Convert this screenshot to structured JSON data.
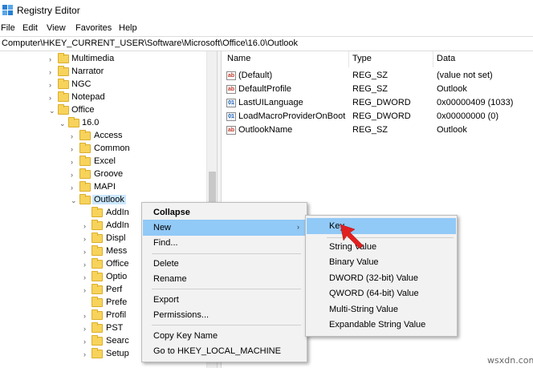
{
  "window": {
    "title": "Registry Editor"
  },
  "menubar": [
    "File",
    "Edit",
    "View",
    "Favorites",
    "Help"
  ],
  "address": "Computer\\HKEY_CURRENT_USER\\Software\\Microsoft\\Office\\16.0\\Outlook",
  "tree": [
    {
      "label": "Multimedia",
      "expanded": false
    },
    {
      "label": "Narrator",
      "expanded": false
    },
    {
      "label": "NGC",
      "expanded": false
    },
    {
      "label": "Notepad",
      "expanded": false
    },
    {
      "label": "Office",
      "expanded": true
    },
    {
      "label": "16.0",
      "expanded": true
    },
    {
      "label": "Access",
      "expanded": false
    },
    {
      "label": "Common",
      "expanded": false
    },
    {
      "label": "Excel",
      "expanded": false
    },
    {
      "label": "Groove",
      "expanded": false
    },
    {
      "label": "MAPI",
      "expanded": false
    },
    {
      "label": "Outlook",
      "expanded": true,
      "selected": true
    },
    {
      "label": "AddIn",
      "expanded": false
    },
    {
      "label": "AddIn",
      "expanded": false
    },
    {
      "label": "Displ",
      "expanded": false
    },
    {
      "label": "Mess",
      "expanded": false
    },
    {
      "label": "Office",
      "expanded": false
    },
    {
      "label": "Optio",
      "expanded": false
    },
    {
      "label": "Perf",
      "expanded": false
    },
    {
      "label": "Prefe",
      "expanded": false
    },
    {
      "label": "Profil",
      "expanded": false
    },
    {
      "label": "PST",
      "expanded": false
    },
    {
      "label": "Searc",
      "expanded": false
    },
    {
      "label": "Setup",
      "expanded": false
    }
  ],
  "values": {
    "headers": {
      "name": "Name",
      "type": "Type",
      "data": "Data"
    },
    "rows": [
      {
        "icon": "string-value-icon",
        "name": "(Default)",
        "type": "REG_SZ",
        "data": "(value not set)"
      },
      {
        "icon": "string-value-icon",
        "name": "DefaultProfile",
        "type": "REG_SZ",
        "data": "Outlook"
      },
      {
        "icon": "dword-value-icon",
        "name": "LastUILanguage",
        "type": "REG_DWORD",
        "data": "0x00000409 (1033)"
      },
      {
        "icon": "dword-value-icon",
        "name": "LoadMacroProviderOnBoot",
        "type": "REG_DWORD",
        "data": "0x00000000 (0)"
      },
      {
        "icon": "string-value-icon",
        "name": "OutlookName",
        "type": "REG_SZ",
        "data": "Outlook"
      }
    ]
  },
  "context_menu": [
    {
      "label": "Collapse",
      "bold": true
    },
    {
      "label": "New",
      "highlighted": true,
      "submenu": true
    },
    {
      "label": "Find..."
    },
    {
      "label": "Delete"
    },
    {
      "label": "Rename"
    },
    {
      "label": "Export"
    },
    {
      "label": "Permissions..."
    },
    {
      "label": "Copy Key Name"
    },
    {
      "label": "Go to HKEY_LOCAL_MACHINE"
    }
  ],
  "new_submenu": [
    {
      "label": "Key",
      "highlighted": true
    },
    {
      "label": "String Value"
    },
    {
      "label": "Binary Value"
    },
    {
      "label": "DWORD (32-bit) Value"
    },
    {
      "label": "QWORD (64-bit) Value"
    },
    {
      "label": "Multi-String Value"
    },
    {
      "label": "Expandable String Value"
    }
  ],
  "icons": {
    "value_string_glyph": "ab",
    "value_dword_glyph": "01",
    "chevron_collapsed": "›",
    "chevron_expanded": "⌄",
    "submenu_arrow": "›"
  },
  "colors": {
    "selection": "#cce8ff",
    "menu_highlight": "#91c9f7",
    "folder": "#f7d35c",
    "annotation_arrow": "#e02020"
  },
  "watermark": "wsxdn.com"
}
